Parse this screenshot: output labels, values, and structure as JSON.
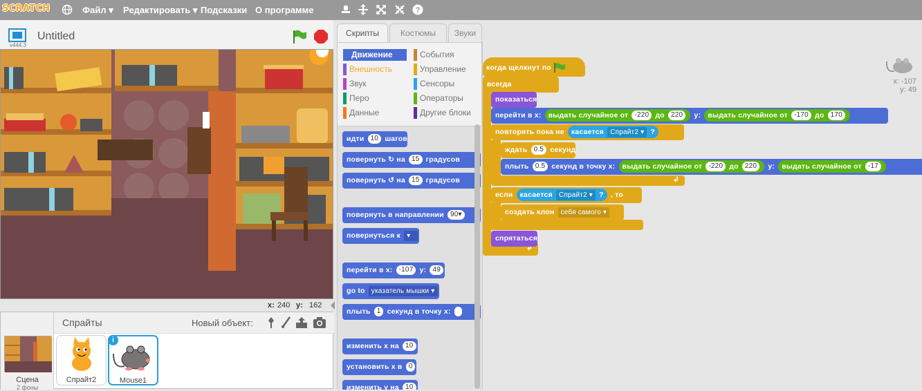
{
  "menubar": {
    "logo": "SCRATCH",
    "items": [
      "Файл ▾",
      "Редактировать ▾",
      "Подсказки",
      "О программе"
    ]
  },
  "stage": {
    "title": "Untitled",
    "version": "v444.3",
    "mouse_x_label": "x:",
    "mouse_x": "240",
    "mouse_y_label": "y:",
    "mouse_y": "162"
  },
  "sprites": {
    "header": "Спрайты",
    "new_object_label": "Новый объект:",
    "scene_label": "Сцена",
    "scene_sub": "2 фоны",
    "items": [
      "Спрайт2",
      "Mouse1"
    ],
    "info_badge": "i"
  },
  "tabs": [
    "Скрипты",
    "Костюмы",
    "Звуки"
  ],
  "categories": {
    "left": [
      "Движение",
      "Внешность",
      "Звук",
      "Перо",
      "Данные"
    ],
    "right": [
      "События",
      "Управление",
      "Сенсоры",
      "Операторы",
      "Другие блоки"
    ],
    "colors_left": [
      "#4a6cd4",
      "#8a55d7",
      "#bb42c3",
      "#0e9a6c",
      "#ee7d16"
    ],
    "colors_right": [
      "#c88330",
      "#e1a91a",
      "#2ca5e2",
      "#5cb712",
      "#632d99"
    ]
  },
  "palette": {
    "move": {
      "a": "идти",
      "v": "10",
      "b": "шагов"
    },
    "turn_right": {
      "a": "повернуть",
      "b": "на",
      "v": "15",
      "c": "градусов"
    },
    "turn_left": {
      "a": "повернуть",
      "b": "на",
      "v": "15",
      "c": "градусов"
    },
    "point_dir": {
      "a": "повернуть в направлении",
      "v": "90▾"
    },
    "point_to": {
      "a": "повернуться к"
    },
    "goto_xy": {
      "a": "перейти в x:",
      "x": "-107",
      "b": "y:",
      "y": "49"
    },
    "goto": {
      "a": "go to",
      "v": "указатель мышки ▾"
    },
    "glide": {
      "a": "плыть",
      "v": "1",
      "b": "секунд в точку x:"
    },
    "change_x": {
      "a": "изменить х на",
      "v": "10"
    },
    "set_x": {
      "a": "установить х в",
      "v": "0"
    },
    "change_y": {
      "a": "изменить у на",
      "v": "10"
    }
  },
  "script": {
    "hat": "когда щелкнут по",
    "forever": "всегда",
    "show": "показаться",
    "goto_a": "перейти в x:",
    "rand": "выдать случайное от",
    "to": "до",
    "y": "y:",
    "rx1": "-220",
    "rx2": "220",
    "ry1": "-170",
    "ry2": "170",
    "repeat_until": "повторять пока не",
    "touching": "касается",
    "sprite_dd": "Спрайт2 ▾",
    "q": "?",
    "wait": "ждать",
    "wait_v": "0.5",
    "wait_b": "секунд",
    "glide": "плыть",
    "glide_v": "0.5",
    "glide_b": "секунд в точку x:",
    "gx1": "-220",
    "gx2": "220",
    "gy_part": "-17",
    "if": "если",
    "then": ", то",
    "clone": "создать клон",
    "clone_dd": "себя самого ▾",
    "hide": "спрятаться",
    "sprite_x": "x: -107",
    "sprite_y": "y: 49"
  }
}
